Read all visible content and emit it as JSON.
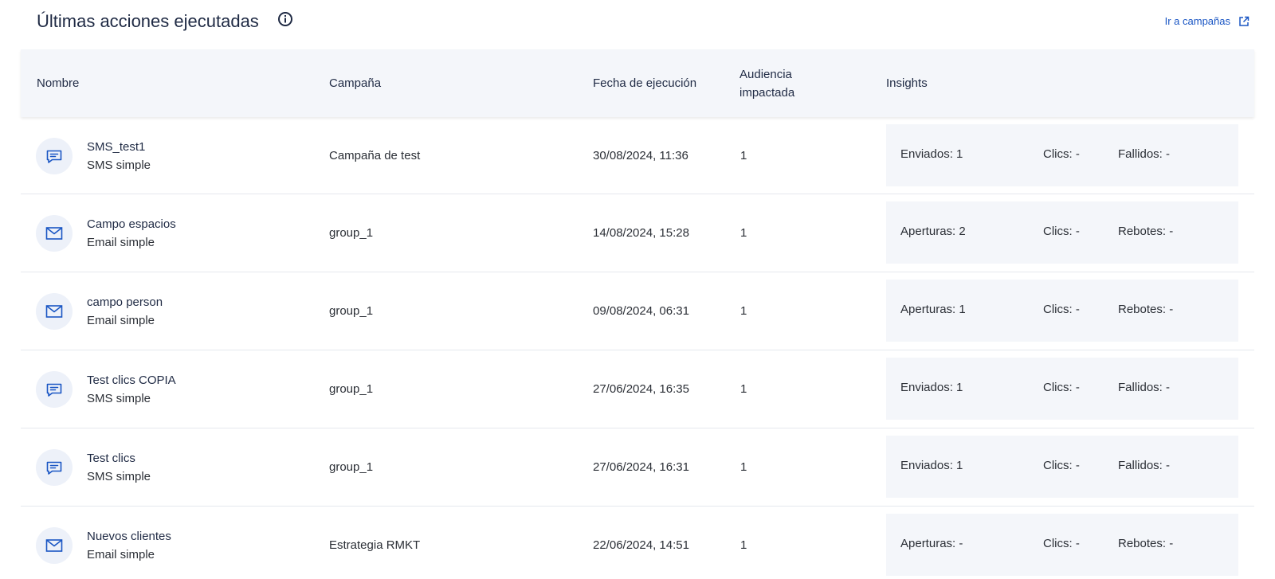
{
  "header": {
    "title": "Últimas acciones ejecutadas",
    "link_label": "Ir a campañas"
  },
  "columns": {
    "nombre": "Nombre",
    "campana": "Campaña",
    "fecha": "Fecha de ejecución",
    "audiencia": "Audiencia impactada",
    "insights": "Insights"
  },
  "rows": [
    {
      "icon": "sms-icon",
      "name": "SMS_test1",
      "type": "SMS simple",
      "campaign": "Campaña de test",
      "date": "30/08/2024, 11:36",
      "audience": "1",
      "insights": [
        "Enviados: 1",
        "Clics: -",
        "Fallidos: -"
      ]
    },
    {
      "icon": "email-icon",
      "name": "Campo espacios",
      "type": "Email simple",
      "campaign": "group_1",
      "date": "14/08/2024, 15:28",
      "audience": "1",
      "insights": [
        "Aperturas: 2",
        "Clics: -",
        "Rebotes: -"
      ]
    },
    {
      "icon": "email-icon",
      "name": "campo person",
      "type": "Email simple",
      "campaign": "group_1",
      "date": "09/08/2024, 06:31",
      "audience": "1",
      "insights": [
        "Aperturas: 1",
        "Clics: -",
        "Rebotes: -"
      ]
    },
    {
      "icon": "sms-icon",
      "name": "Test clics COPIA",
      "type": "SMS simple",
      "campaign": "group_1",
      "date": "27/06/2024, 16:35",
      "audience": "1",
      "insights": [
        "Enviados: 1",
        "Clics: -",
        "Fallidos: -"
      ]
    },
    {
      "icon": "sms-icon",
      "name": "Test clics",
      "type": "SMS simple",
      "campaign": "group_1",
      "date": "27/06/2024, 16:31",
      "audience": "1",
      "insights": [
        "Enviados: 1",
        "Clics: -",
        "Fallidos: -"
      ]
    },
    {
      "icon": "email-icon",
      "name": "Nuevos clientes",
      "type": "Email simple",
      "campaign": "Estrategia RMKT",
      "date": "22/06/2024, 14:51",
      "audience": "1",
      "insights": [
        "Aperturas: -",
        "Clics: -",
        "Rebotes: -"
      ]
    }
  ],
  "colors": {
    "accent": "#1a56c4",
    "header_bg": "#f4f6fa",
    "icon_bg": "#edf1f9",
    "title": "#1f2a44"
  }
}
